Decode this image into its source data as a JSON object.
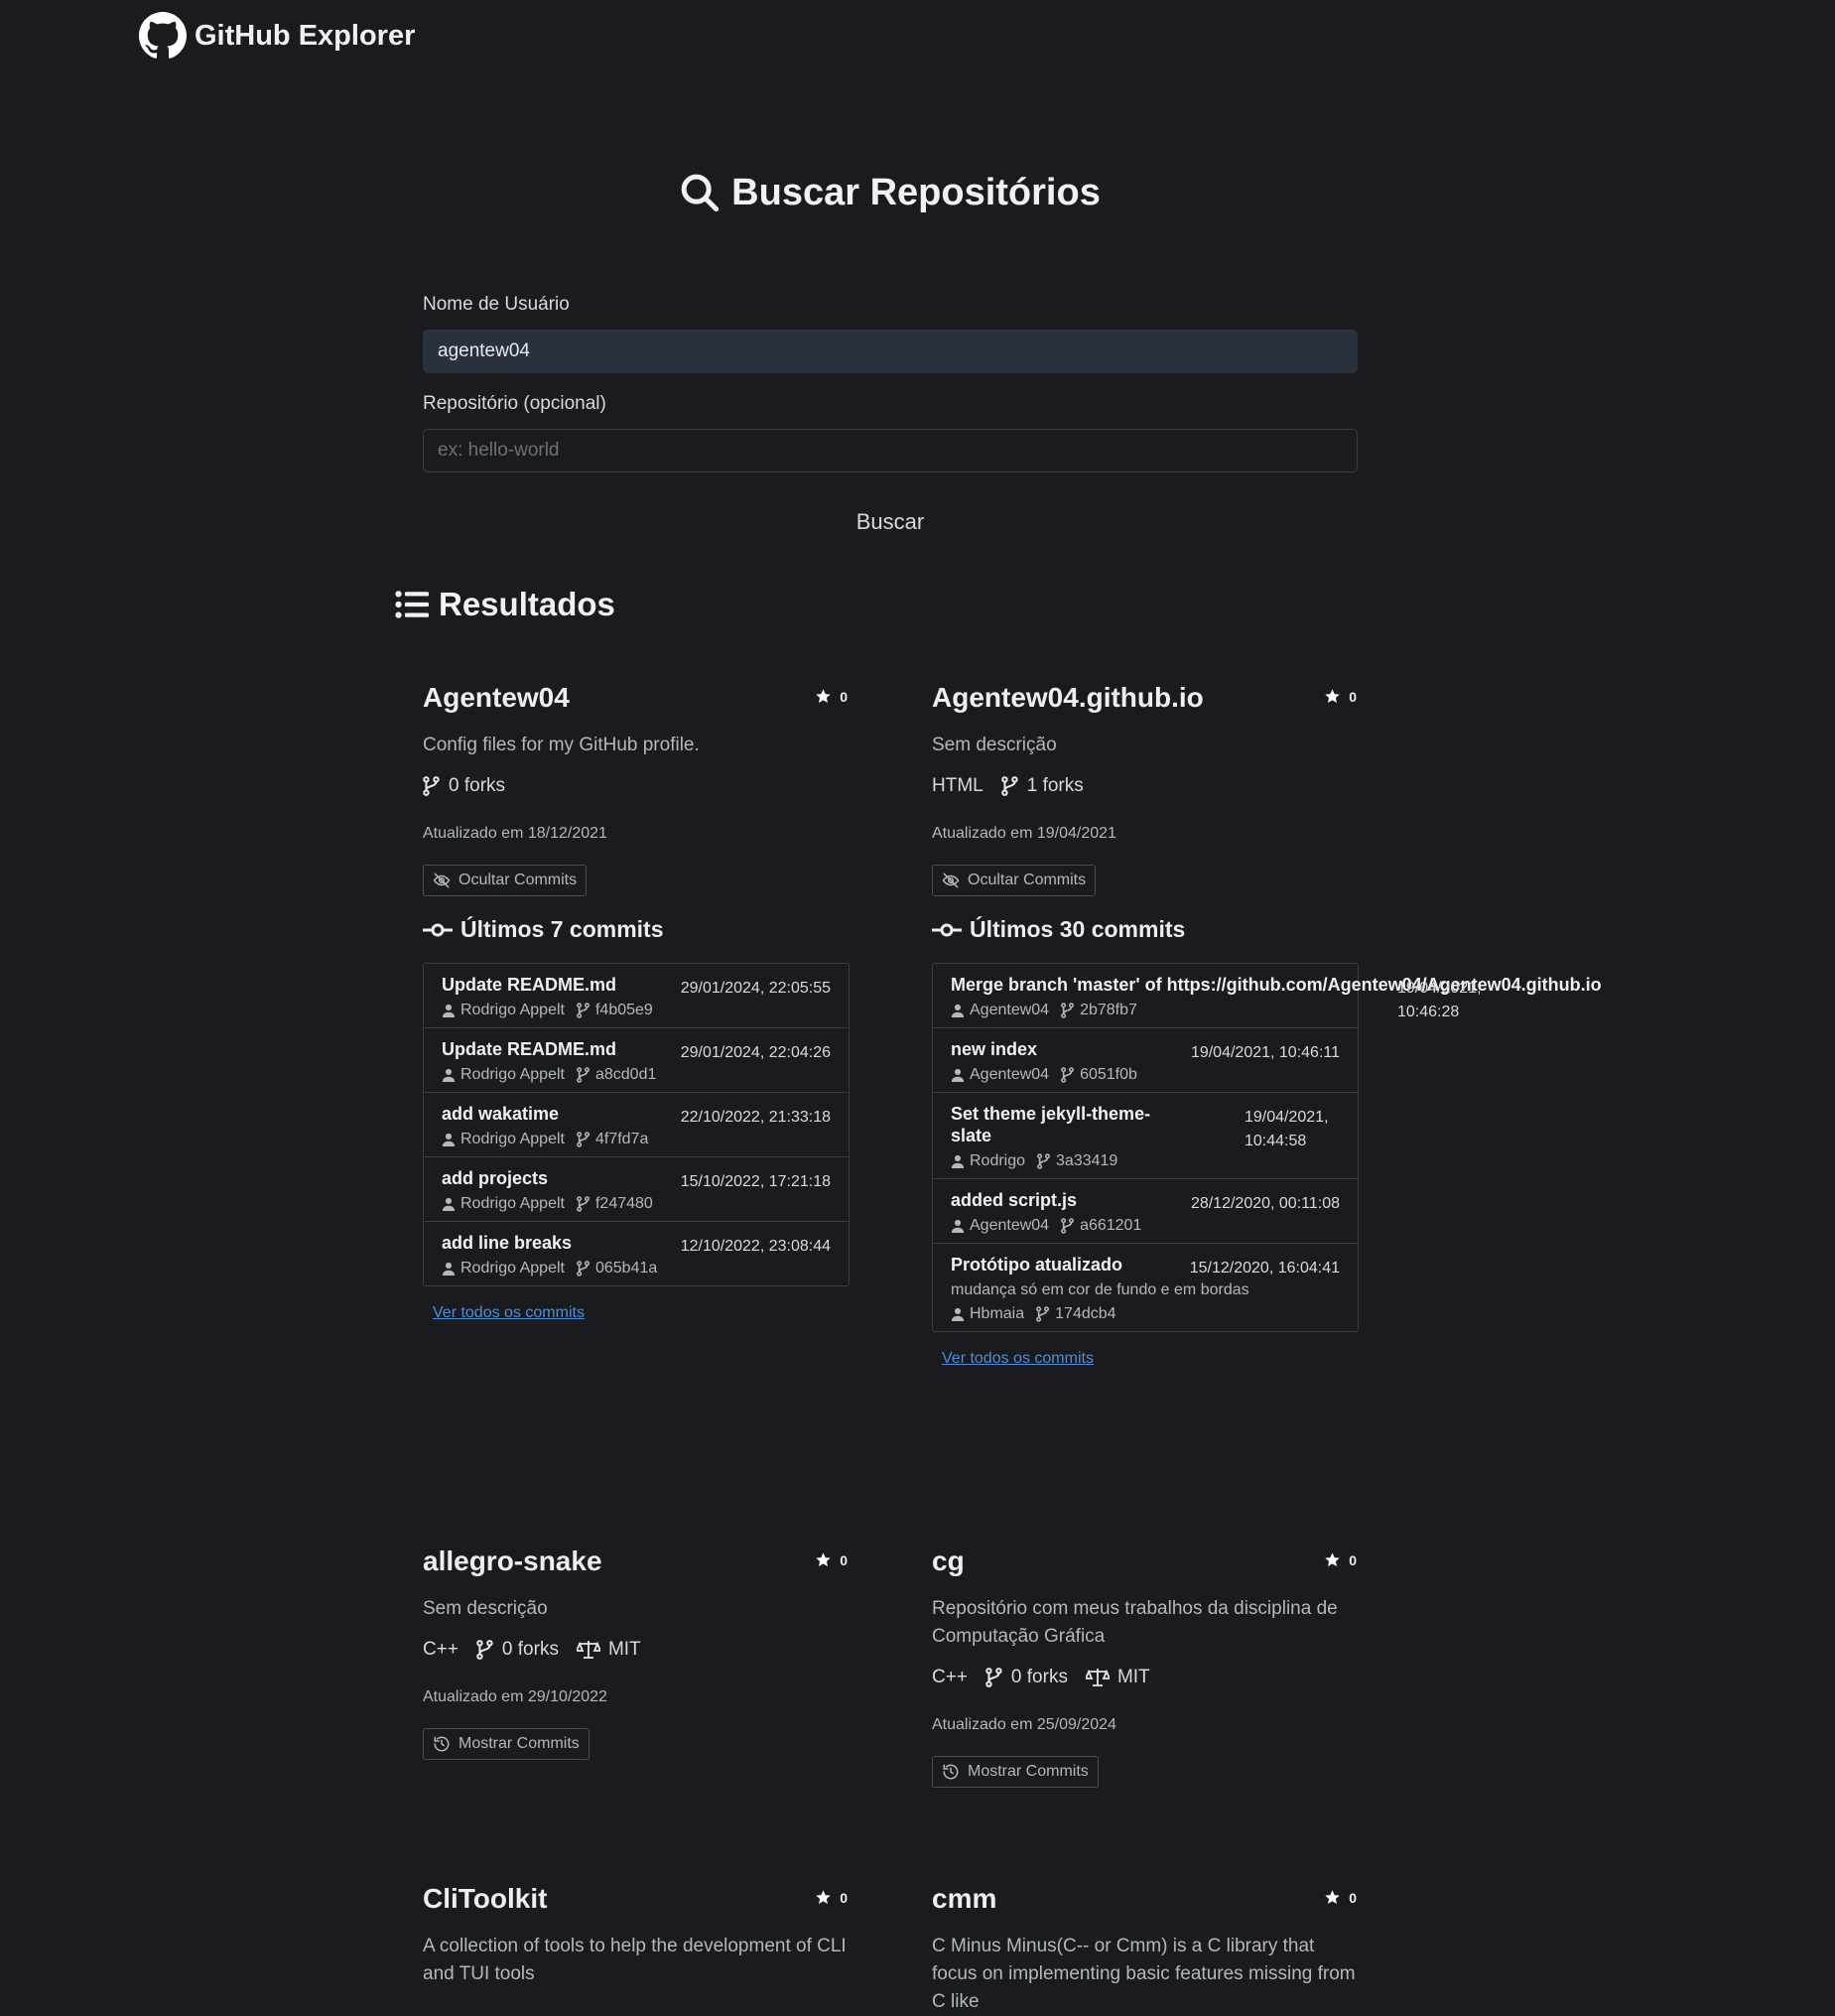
{
  "header": {
    "title": "GitHub Explorer"
  },
  "search": {
    "title": "Buscar Repositórios",
    "username_label": "Nome de Usuário",
    "username_value": "agentew04",
    "repo_label": "Repositório (opcional)",
    "repo_placeholder": "ex: hello-world",
    "button_label": "Buscar"
  },
  "results": {
    "title": "Resultados",
    "repos": [
      {
        "name": "Agentew04",
        "stars": "0",
        "description": "Config files for my GitHub profile.",
        "language": "",
        "forks": "0 forks",
        "license": "",
        "updated": "Atualizado em 18/12/2021",
        "toggle_label": "Ocultar Commits",
        "commits_title": "Últimos 7 commits",
        "commits": [
          {
            "message": "Update README.md",
            "date": "29/01/2024, 22:05:55",
            "author": "Rodrigo Appelt",
            "sha": "f4b05e9"
          },
          {
            "message": "Update README.md",
            "date": "29/01/2024, 22:04:26",
            "author": "Rodrigo Appelt",
            "sha": "a8cd0d1"
          },
          {
            "message": "add wakatime",
            "date": "22/10/2022, 21:33:18",
            "author": "Rodrigo Appelt",
            "sha": "4f7fd7a"
          },
          {
            "message": "add projects",
            "date": "15/10/2022, 17:21:18",
            "author": "Rodrigo Appelt",
            "sha": "f247480"
          },
          {
            "message": "add line breaks",
            "date": "12/10/2022, 23:08:44",
            "author": "Rodrigo Appelt",
            "sha": "065b41a"
          }
        ],
        "view_all": "Ver todos os commits"
      },
      {
        "name": "Agentew04.github.io",
        "stars": "0",
        "description": "Sem descrição",
        "language": "HTML",
        "forks": "1 forks",
        "license": "",
        "updated": "Atualizado em 19/04/2021",
        "toggle_label": "Ocultar Commits",
        "commits_title": "Últimos 30 commits",
        "commits": [
          {
            "message": "Merge branch 'master' of https://github.com/Agentew04/Agentew04.github.io",
            "date": "19/04/2021, 10:46:28",
            "author": "Agentew04",
            "sha": "2b78fb7"
          },
          {
            "message": "new index",
            "date": "19/04/2021, 10:46:11",
            "author": "Agentew04",
            "sha": "6051f0b"
          },
          {
            "message": "Set theme jekyll-theme-slate",
            "date": "19/04/2021, 10:44:58",
            "author": "Rodrigo",
            "sha": "3a33419"
          },
          {
            "message": "added script.js",
            "date": "28/12/2020, 00:11:08",
            "author": "Agentew04",
            "sha": "a661201"
          },
          {
            "message": "Protótipo atualizado",
            "body": "mudança só em cor de fundo e em bordas",
            "date": "15/12/2020, 16:04:41",
            "author": "Hbmaia",
            "sha": "174dcb4"
          }
        ],
        "view_all": "Ver todos os commits"
      },
      {
        "name": "allegro-snake",
        "stars": "0",
        "description": "Sem descrição",
        "language": "C++",
        "forks": "0 forks",
        "license": "MIT",
        "updated": "Atualizado em 29/10/2022",
        "toggle_label": "Mostrar Commits"
      },
      {
        "name": "cg",
        "stars": "0",
        "description": "Repositório com meus trabalhos da disciplina de Computação Gráfica",
        "language": "C++",
        "forks": "0 forks",
        "license": "MIT",
        "updated": "Atualizado em 25/09/2024",
        "toggle_label": "Mostrar Commits"
      },
      {
        "name": "CliToolkit",
        "stars": "0",
        "description": "A collection of tools to help the development of CLI and TUI tools"
      },
      {
        "name": "cmm",
        "stars": "0",
        "description": "C Minus Minus(C-- or Cmm) is a C library that focus on implementing basic features missing from C like"
      }
    ]
  }
}
